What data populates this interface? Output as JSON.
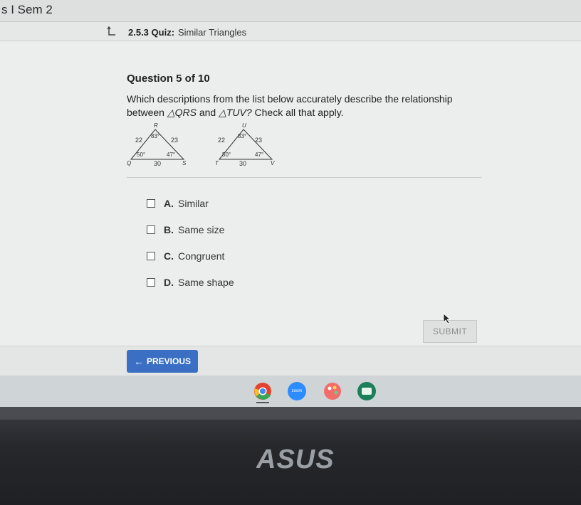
{
  "course": {
    "title": "s I Sem 2"
  },
  "quiz": {
    "number": "2.5.3",
    "label": "Quiz:",
    "name": "Similar Triangles"
  },
  "question": {
    "header": "Question 5 of 10",
    "text_part1": "Which descriptions from the list below accurately describe the relationship",
    "text_part2": "between",
    "tri1": "△QRS",
    "and": "and",
    "tri2": "△TUV?",
    "text_part3": "Check all that apply."
  },
  "triangle1": {
    "top": "R",
    "left": "Q",
    "right": "S",
    "side_left": "22",
    "side_right": "23",
    "base": "30",
    "angle_top": "83°",
    "angle_left": "50°",
    "angle_right": "47°"
  },
  "triangle2": {
    "top": "U",
    "left": "T",
    "right": "V",
    "side_left": "22",
    "side_right": "23",
    "base": "30",
    "angle_top": "83°",
    "angle_left": "50°",
    "angle_right": "47°"
  },
  "options": [
    {
      "letter": "A.",
      "text": "Similar",
      "checked": false
    },
    {
      "letter": "B.",
      "text": "Same size",
      "checked": false
    },
    {
      "letter": "C.",
      "text": "Congruent",
      "checked": false
    },
    {
      "letter": "D.",
      "text": "Same shape",
      "checked": false
    }
  ],
  "buttons": {
    "submit": "SUBMIT",
    "previous": "PREVIOUS"
  },
  "taskbar": {
    "zoom_label": "zoom"
  },
  "brand": {
    "logo_text": "ASUS"
  },
  "colors": {
    "accent": "#3b6fc4"
  }
}
